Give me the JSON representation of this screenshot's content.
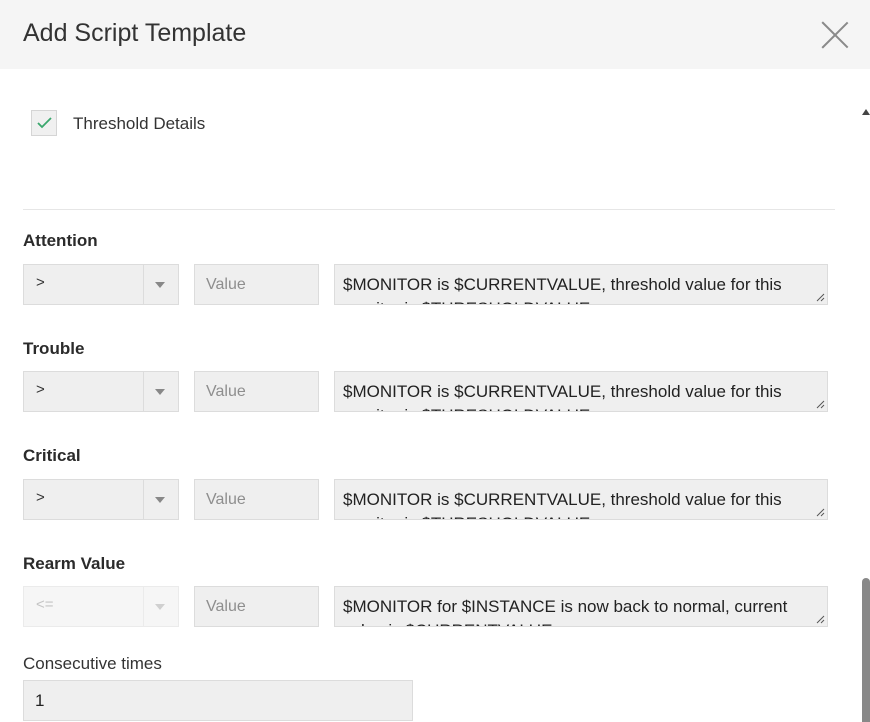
{
  "dialog": {
    "title": "Add Script Template"
  },
  "threshold": {
    "checked": true,
    "label": "Threshold Details"
  },
  "sections": [
    {
      "label": "Attention",
      "operator": ">",
      "value_placeholder": "Value",
      "message": "$MONITOR is $CURRENTVALUE, threshold value for this monitor is $THRESHOLDVALUE"
    },
    {
      "label": "Trouble",
      "operator": ">",
      "value_placeholder": "Value",
      "message": "$MONITOR is $CURRENTVALUE, threshold value for this monitor is $THRESHOLDVALUE"
    },
    {
      "label": "Critical",
      "operator": ">",
      "value_placeholder": "Value",
      "message": "$MONITOR is $CURRENTVALUE, threshold value for this monitor is $THRESHOLDVALUE"
    },
    {
      "label": "Rearm Value",
      "operator": "<=",
      "operator_disabled": true,
      "value_placeholder": "Value",
      "message": "$MONITOR for $INSTANCE is now back to normal, current value is $CURRENTVALUE"
    }
  ],
  "consecutive": {
    "label": "Consecutive times",
    "value": "1"
  },
  "colors": {
    "check": "#3aa76d",
    "header_bg": "#f5f5f5",
    "field_bg": "#efefef"
  }
}
